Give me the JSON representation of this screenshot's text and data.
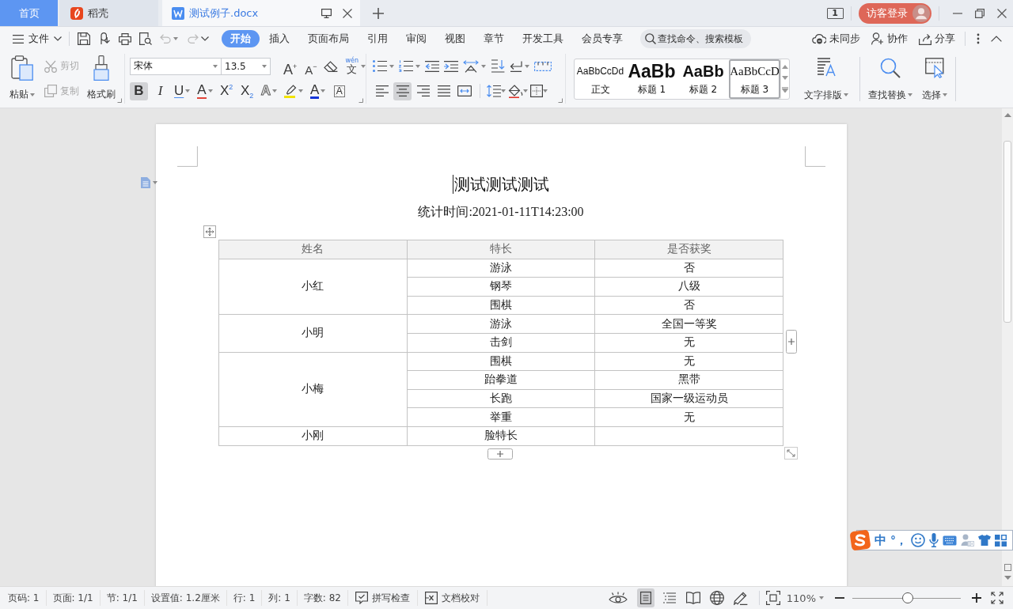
{
  "title_bar": {
    "tabs": [
      {
        "kind": "home",
        "label": "首页",
        "selected": false
      },
      {
        "kind": "app",
        "label": "稻壳",
        "selected": false
      },
      {
        "kind": "document",
        "label": "测试例子.docx",
        "selected": true
      }
    ],
    "window_count": "1",
    "account": {
      "label": "访客登录"
    }
  },
  "menu_bar": {
    "file_menu": "文件",
    "quick_access": [
      {
        "kind": "save",
        "disabled": false
      },
      {
        "kind": "export",
        "disabled": false
      },
      {
        "kind": "print",
        "disabled": false
      },
      {
        "kind": "preview",
        "disabled": false
      },
      {
        "kind": "undo",
        "disabled": true
      },
      {
        "kind": "redo",
        "disabled": true
      }
    ],
    "tabs": [
      {
        "label": "开始",
        "selected": true
      },
      {
        "label": "插入",
        "selected": false
      },
      {
        "label": "页面布局",
        "selected": false
      },
      {
        "label": "引用",
        "selected": false
      },
      {
        "label": "审阅",
        "selected": false
      },
      {
        "label": "视图",
        "selected": false
      },
      {
        "label": "章节",
        "selected": false
      },
      {
        "label": "开发工具",
        "selected": false
      },
      {
        "label": "会员专享",
        "selected": false
      }
    ],
    "search": {
      "placeholder": "查找命令、搜索模板"
    },
    "actions": [
      {
        "kind": "sync",
        "label": "未同步"
      },
      {
        "kind": "collaborate",
        "label": "协作"
      },
      {
        "kind": "share",
        "label": "分享"
      }
    ]
  },
  "ribbon": {
    "clipboard": [
      {
        "kind": "paste",
        "label": "粘贴",
        "disabled": false
      },
      {
        "kind": "cut",
        "label": "剪切",
        "disabled": true
      },
      {
        "kind": "copy",
        "label": "复制",
        "disabled": true
      },
      {
        "kind": "format_painter",
        "label": "格式刷",
        "disabled": false
      }
    ],
    "font": {
      "name": "宋体",
      "size": "13.5",
      "size_buttons": [
        {
          "kind": "grow",
          "glyph": "A$^{+}$"
        },
        {
          "kind": "shrink",
          "glyph": "A$^{−}$"
        }
      ],
      "pinyin": {
        "ruby": "wén",
        "glyph": "文"
      },
      "format_buttons": [
        {
          "kind": "bold",
          "glyph": "B",
          "selected": true
        },
        {
          "kind": "italic",
          "glyph": "I",
          "selected": false
        },
        {
          "kind": "underline",
          "glyph": "U",
          "selected": false
        },
        {
          "kind": "strikethrough",
          "glyph": "A",
          "selected": false
        },
        {
          "kind": "superscript",
          "glyph": "X$^{2}$",
          "selected": false
        },
        {
          "kind": "subscript",
          "glyph": "X$_{2}$",
          "selected": false
        },
        {
          "kind": "effect",
          "glyph": "A",
          "selected": false
        },
        {
          "kind": "highlight",
          "selected": false
        },
        {
          "kind": "font_color",
          "glyph": "A",
          "selected": false
        },
        {
          "kind": "char_border",
          "glyph": "A",
          "selected": false
        }
      ]
    },
    "paragraph": {
      "alignment": [
        {
          "kind": "left",
          "selected": false
        },
        {
          "kind": "center",
          "selected": true
        },
        {
          "kind": "right",
          "selected": false
        },
        {
          "kind": "justify",
          "selected": false
        },
        {
          "kind": "distributed",
          "selected": false
        }
      ]
    },
    "styles": [
      {
        "kind": "body",
        "preview": "AaBbCcDd",
        "label": "正文",
        "selected": false
      },
      {
        "kind": "heading1",
        "preview": "AaBb",
        "label": "标题 1",
        "selected": false
      },
      {
        "kind": "heading2",
        "preview": "AaBb",
        "label": "标题 2",
        "selected": false
      },
      {
        "kind": "heading3",
        "preview": "AaBbCcD",
        "label": "标题 3",
        "selected": true
      }
    ],
    "tools": [
      {
        "kind": "text_layout",
        "label": "文字排版"
      },
      {
        "kind": "find_replace",
        "label": "查找替换"
      },
      {
        "kind": "select",
        "label": "选择"
      }
    ]
  },
  "document": {
    "title": "测试测试测试",
    "subtitle": "统计时间:2021-01-11T14:23:00",
    "table": {
      "columns": [
        "姓名",
        "特长",
        "是否获奖"
      ],
      "groups": [
        {
          "name": "小红",
          "rows": [
            {
              "skill": "游泳",
              "award": "否"
            },
            {
              "skill": "钢琴",
              "award": "八级"
            },
            {
              "skill": "围棋",
              "award": "否"
            }
          ]
        },
        {
          "name": "小明",
          "rows": [
            {
              "skill": "游泳",
              "award": "全国一等奖"
            },
            {
              "skill": "击剑",
              "award": "无"
            }
          ]
        },
        {
          "name": "小梅",
          "rows": [
            {
              "skill": "围棋",
              "award": "无"
            },
            {
              "skill": "跆拳道",
              "award": "黑带"
            },
            {
              "skill": "长跑",
              "award": "国家一级运动员"
            },
            {
              "skill": "举重",
              "award": "无"
            }
          ]
        },
        {
          "name": "小刚",
          "rows": [
            {
              "skill": "脸特长"
            }
          ]
        }
      ]
    }
  },
  "ime_bar": {
    "mode": "中",
    "punctuation": "°，"
  },
  "status_bar": {
    "items": [
      "页码: 1",
      "页面: 1/1",
      "节: 1/1",
      "设置值: 1.2厘米",
      "行: 1",
      "列: 1",
      "字数: 82"
    ],
    "tools": [
      {
        "kind": "spell_check",
        "label": "拼写检查"
      },
      {
        "kind": "proofread",
        "label": "文档校对"
      }
    ],
    "views": [
      {
        "kind": "page",
        "selected": true
      },
      {
        "kind": "outline",
        "selected": false
      },
      {
        "kind": "reading",
        "selected": false
      },
      {
        "kind": "web",
        "selected": false
      },
      {
        "kind": "pen",
        "selected": false
      }
    ],
    "zoom": {
      "reading": "110%",
      "level": 0.5
    }
  }
}
